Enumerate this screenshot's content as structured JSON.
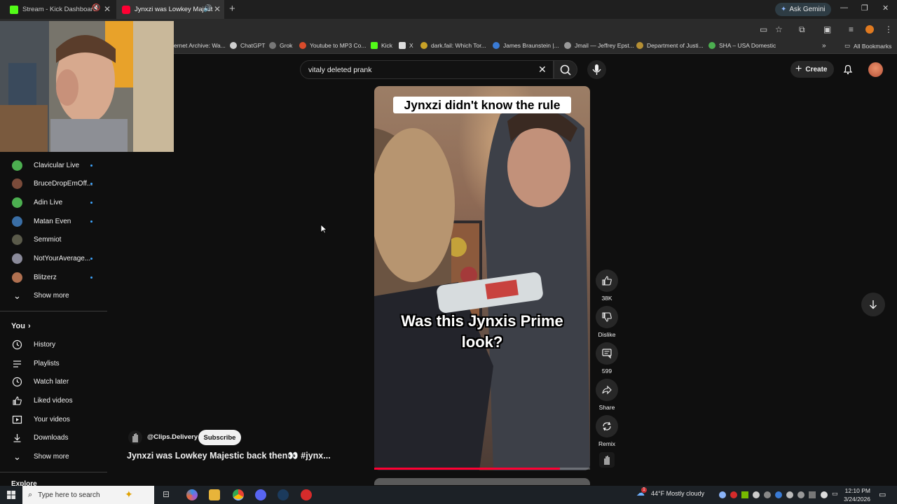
{
  "browser": {
    "tabs": [
      {
        "title": "Stream - Kick Dashboard",
        "active": false
      },
      {
        "title": "Jynxzi was Lowkey Majestic",
        "active": true
      }
    ],
    "ask_gemini": "Ask Gemini",
    "bookmarks": [
      "ernet Archive: Wa...",
      "ChatGPT",
      "Grok",
      "Youtube to MP3 Co...",
      "Kick",
      "X",
      "dark.fail: Which Tor...",
      "James Braunstein |...",
      "Jmail — Jeffrey Epst...",
      "Department of Justi...",
      "SHA – USA Domestic"
    ],
    "all_bookmarks": "All Bookmarks"
  },
  "youtube": {
    "search_value": "vitaly deleted prank",
    "create_label": "Create",
    "sidebar": {
      "subscriptions": [
        {
          "name": "Clavicular Live",
          "live": true,
          "color": "#4caf50"
        },
        {
          "name": "BruceDropEmOff...",
          "live": true,
          "color": "#7a4b3a"
        },
        {
          "name": "Adin Live",
          "live": true,
          "color": "#4caf50"
        },
        {
          "name": "Matan Even",
          "live": true,
          "color": "#3a6ea5"
        },
        {
          "name": "Semmiot",
          "live": false,
          "color": "#5a5a4a"
        },
        {
          "name": "NotYourAverage...",
          "live": true,
          "color": "#8a8a9a"
        },
        {
          "name": "Blitzerz",
          "live": true,
          "color": "#b07050"
        }
      ],
      "show_more": "Show more",
      "you_heading": "You",
      "you_items": [
        {
          "label": "History",
          "icon": "history-icon"
        },
        {
          "label": "Playlists",
          "icon": "playlists-icon"
        },
        {
          "label": "Watch later",
          "icon": "watch-later-icon"
        },
        {
          "label": "Liked videos",
          "icon": "thumbs-up-icon"
        },
        {
          "label": "Your videos",
          "icon": "play-square-icon"
        },
        {
          "label": "Downloads",
          "icon": "download-icon"
        }
      ],
      "show_more_2": "Show more",
      "explore_heading": "Explore"
    },
    "short": {
      "caption_top": "Jynxzi didn't know the rule",
      "caption_mid": "Was this Jynxis Prime look?",
      "progress": 0.86,
      "channel": "@Clips.Delivery",
      "subscribe": "Subscribe",
      "title": "Jynxzi was Lowkey Majestic back then👀 #jynx..."
    },
    "actions": {
      "likes": "38K",
      "dislike": "Dislike",
      "comments": "599",
      "share": "Share",
      "remix": "Remix"
    }
  },
  "taskbar": {
    "search_placeholder": "Type here to search",
    "weather_badge": "1",
    "weather": "44°F  Mostly cloudy",
    "time": "12:10 PM",
    "date": "3/24/2026"
  },
  "colors": {
    "accent_red": "#ff0033",
    "live_dot": "#3ea6ff"
  }
}
